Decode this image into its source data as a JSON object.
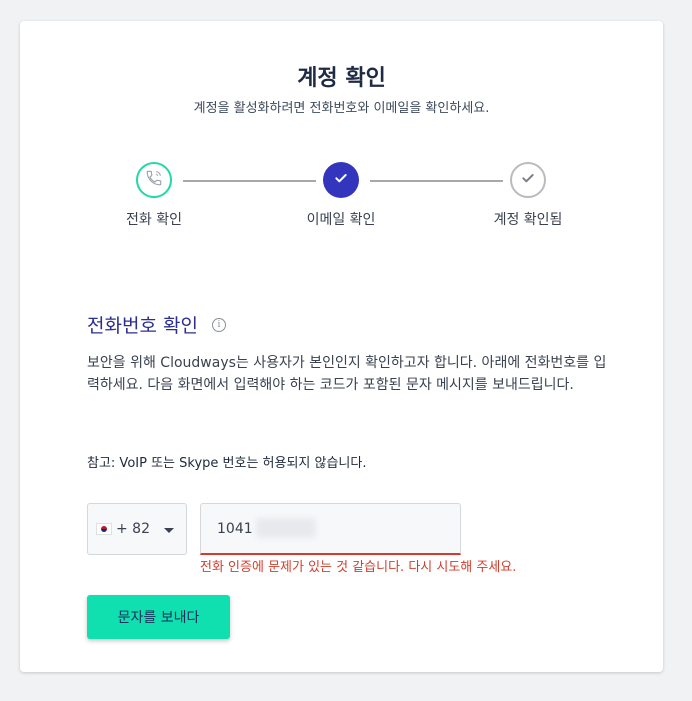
{
  "page": {
    "title": "계정 확인",
    "subtitle": "계정을 활성화하려면 전화번호와 이메일을 확인하세요."
  },
  "steps": [
    {
      "label": "전화 확인",
      "state": "current",
      "icon": "phone-icon"
    },
    {
      "label": "이메일 확인",
      "state": "done",
      "icon": "check-icon"
    },
    {
      "label": "계정 확인됨",
      "state": "pending",
      "icon": "check-icon"
    }
  ],
  "section": {
    "title": "전화번호 확인",
    "info_icon": "ⓘ",
    "description": "보안을 위해 Cloudways는 사용자가 본인인지 확인하고자 합니다. 아래에 전화번호를 입력하세요. 다음 화면에서 입력해야 하는 코드가 포함된 문자 메시지를 보내드립니다.",
    "note": "참고: VoIP 또는 Skype 번호는 허용되지 않습니다."
  },
  "phone": {
    "country_code": "+ 82",
    "country_flag": "south-korea-flag",
    "value": "1041",
    "error": "전화 인증에 문제가 있는 것 같습니다. 다시 시도해 주세요."
  },
  "actions": {
    "send_label": "문자를 보내다"
  },
  "colors": {
    "accent": "#10e0b0",
    "step_done": "#3336bd",
    "error": "#d0402c"
  }
}
